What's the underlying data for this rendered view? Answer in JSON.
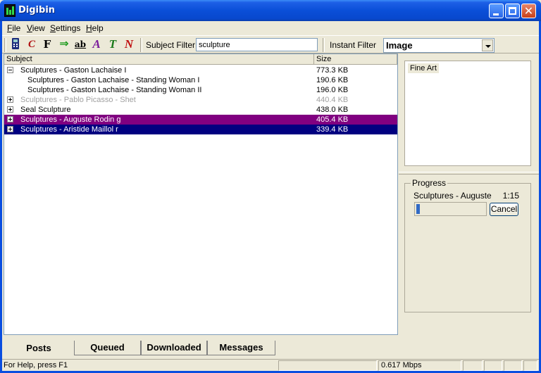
{
  "window": {
    "title": "Digibin"
  },
  "menu": [
    {
      "key": "F",
      "rest": "ile"
    },
    {
      "key": "V",
      "rest": "iew"
    },
    {
      "key": "S",
      "rest": "ettings"
    },
    {
      "key": "H",
      "rest": "elp"
    }
  ],
  "toolbar": {
    "icons": [
      "phone-icon",
      "c-icon",
      "f-icon",
      "arrow-right-icon",
      "scissors-icon",
      "a-icon",
      "t-icon",
      "n-icon"
    ],
    "glyphs": {
      "c": "C",
      "f": "F",
      "arrow": "⇒",
      "ab": "ab",
      "a": "A",
      "t": "T",
      "n": "N"
    },
    "subject_filter_label": "Subject Filter:",
    "subject_filter_value": "sculpture",
    "instant_filter_label": "Instant Filter",
    "type_select_value": "Image"
  },
  "list": {
    "columns": [
      "Subject",
      "Size"
    ],
    "rows": [
      {
        "subject": "Sculptures - Gaston Lachaise I",
        "size": "773.3 KB"
      },
      {
        "subject": "Sculptures - Gaston Lachaise - Standing Woman I",
        "size": "190.6 KB"
      },
      {
        "subject": "Sculptures - Gaston Lachaise - Standing Woman II",
        "size": "196.0 KB"
      },
      {
        "subject": "Sculptures - Pablo Picasso - Shet",
        "size": "440.4 KB"
      },
      {
        "subject": "Seal Sculpture",
        "size": "438.0 KB"
      },
      {
        "subject": "Sculptures - Auguste Rodin g",
        "size": "405.4 KB"
      },
      {
        "subject": "Sculptures - Aristide Maillol r",
        "size": "339.4 KB"
      }
    ]
  },
  "tabs": [
    "Posts",
    "Queued",
    "Downloaded",
    "Messages"
  ],
  "categories": [
    "Fine Art"
  ],
  "progress": {
    "legend": "Progress",
    "item": "Sculptures - Auguste",
    "time": "1:15",
    "fraction": 0.05,
    "cancel_label": "Cancel"
  },
  "status": {
    "help": "For Help, press F1",
    "speed": "0.617 Mbps"
  },
  "colors": {
    "selected_purple": "#800080",
    "selected_navy": "#000080",
    "faded_text": "#a0a0a0",
    "progress_fill": "#316ac5"
  }
}
